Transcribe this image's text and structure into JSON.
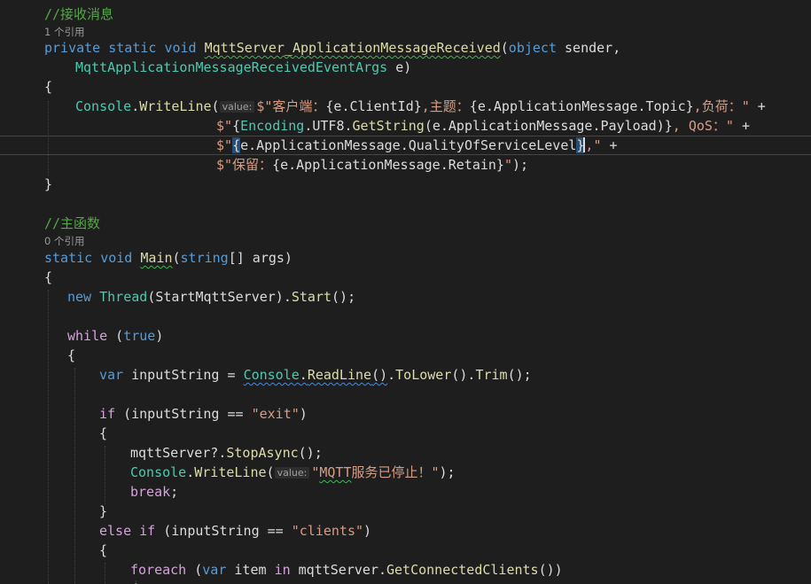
{
  "editor": {
    "theme": {
      "background": "#1e1e1e",
      "keyword": "#569cd6",
      "type": "#4ec9b0",
      "method": "#dcdcaa",
      "string": "#d69d85",
      "comment": "#57a64a",
      "control": "#d8a0df"
    },
    "lines": [
      {
        "kind": "code",
        "tokens": [
          {
            "t": "//接收消息",
            "c": "comment"
          }
        ]
      },
      {
        "kind": "lens",
        "tokens": [
          {
            "t": "1 个引用",
            "c": "lens"
          }
        ]
      },
      {
        "kind": "code",
        "tokens": [
          {
            "t": "private",
            "c": "kw"
          },
          {
            "t": " ",
            "c": "id"
          },
          {
            "t": "static",
            "c": "kw"
          },
          {
            "t": " ",
            "c": "id"
          },
          {
            "t": "void",
            "c": "kw"
          },
          {
            "t": " ",
            "c": "id"
          },
          {
            "t": "MqttServer_ApplicationMessageReceived",
            "c": "method",
            "u": "squig"
          },
          {
            "t": "(",
            "c": "id"
          },
          {
            "t": "object",
            "c": "kw"
          },
          {
            "t": " sender,",
            "c": "id"
          }
        ]
      },
      {
        "kind": "code",
        "tokens": [
          {
            "t": "MqttApplicationMessageReceivedEventArgs",
            "c": "type"
          },
          {
            "t": " e)",
            "c": "id"
          }
        ]
      },
      {
        "kind": "code",
        "tokens": [
          {
            "t": "{",
            "c": "id"
          }
        ]
      },
      {
        "kind": "code",
        "tokens": [
          {
            "t": "Console",
            "c": "type"
          },
          {
            "t": ".",
            "c": "id"
          },
          {
            "t": "WriteLine",
            "c": "method"
          },
          {
            "t": "(",
            "c": "id"
          },
          {
            "t": "value:",
            "c": "hint"
          },
          {
            "t": "$\"客户端：",
            "c": "str"
          },
          {
            "t": "{e.ClientId}",
            "c": "id"
          },
          {
            "t": ",主题：",
            "c": "str"
          },
          {
            "t": "{e.ApplicationMessage.Topic}",
            "c": "id"
          },
          {
            "t": ",负荷：\"",
            "c": "str"
          },
          {
            "t": " +",
            "c": "id"
          }
        ]
      },
      {
        "kind": "code",
        "tokens": [
          {
            "t": "$\"",
            "c": "str"
          },
          {
            "t": "{",
            "c": "id"
          },
          {
            "t": "Encoding",
            "c": "type"
          },
          {
            "t": ".UTF8.",
            "c": "id"
          },
          {
            "t": "GetString",
            "c": "method"
          },
          {
            "t": "(e.ApplicationMessage.Payload)}",
            "c": "id"
          },
          {
            "t": ", QoS：\"",
            "c": "str"
          },
          {
            "t": " +",
            "c": "id"
          }
        ]
      },
      {
        "kind": "code",
        "tokens": [
          {
            "t": "$\"",
            "c": "str"
          },
          {
            "t": "{",
            "c": "id",
            "u": "sel"
          },
          {
            "t": "e.ApplicationMessage.QualityOfServiceLevel",
            "c": "id"
          },
          {
            "t": "}",
            "c": "id",
            "u": "sel"
          },
          {
            "t": ",\"",
            "c": "str"
          },
          {
            "t": " +",
            "c": "id"
          }
        ]
      },
      {
        "kind": "code",
        "tokens": [
          {
            "t": "$\"保留：",
            "c": "str"
          },
          {
            "t": "{e.ApplicationMessage.Retain}",
            "c": "id"
          },
          {
            "t": "\"",
            "c": "str"
          },
          {
            "t": ");",
            "c": "id"
          }
        ]
      },
      {
        "kind": "code",
        "tokens": [
          {
            "t": "}",
            "c": "id"
          }
        ]
      },
      {
        "kind": "code",
        "tokens": [
          {
            "t": "//主函数",
            "c": "comment"
          }
        ]
      },
      {
        "kind": "lens",
        "tokens": [
          {
            "t": "0 个引用",
            "c": "lens"
          }
        ]
      },
      {
        "kind": "code",
        "tokens": [
          {
            "t": "static",
            "c": "kw"
          },
          {
            "t": " ",
            "c": "id"
          },
          {
            "t": "void",
            "c": "kw"
          },
          {
            "t": " ",
            "c": "id"
          },
          {
            "t": "Main",
            "c": "method",
            "u": "squig"
          },
          {
            "t": "(",
            "c": "id"
          },
          {
            "t": "string",
            "c": "kw"
          },
          {
            "t": "[] args)",
            "c": "id"
          }
        ]
      },
      {
        "kind": "code",
        "tokens": [
          {
            "t": "{",
            "c": "id"
          }
        ]
      },
      {
        "kind": "code",
        "tokens": [
          {
            "t": "new",
            "c": "kw"
          },
          {
            "t": " ",
            "c": "id"
          },
          {
            "t": "Thread",
            "c": "type"
          },
          {
            "t": "(StartMqttServer).",
            "c": "id"
          },
          {
            "t": "Start",
            "c": "method"
          },
          {
            "t": "();",
            "c": "id"
          }
        ]
      },
      {
        "kind": "code",
        "tokens": [
          {
            "t": "while",
            "c": "control"
          },
          {
            "t": " (",
            "c": "id"
          },
          {
            "t": "true",
            "c": "kw"
          },
          {
            "t": ")",
            "c": "id"
          }
        ]
      },
      {
        "kind": "code",
        "tokens": [
          {
            "t": "{",
            "c": "id"
          }
        ]
      },
      {
        "kind": "code",
        "tokens": [
          {
            "t": "var",
            "c": "kw"
          },
          {
            "t": " inputString = ",
            "c": "id"
          },
          {
            "t": "Console",
            "c": "type",
            "u": "squigb"
          },
          {
            "t": ".",
            "c": "id",
            "u": "squigb"
          },
          {
            "t": "ReadLine",
            "c": "method",
            "u": "squigb"
          },
          {
            "t": "()",
            "c": "id",
            "u": "squigb"
          },
          {
            "t": ".",
            "c": "id"
          },
          {
            "t": "ToLower",
            "c": "method"
          },
          {
            "t": "().",
            "c": "id"
          },
          {
            "t": "Trim",
            "c": "method"
          },
          {
            "t": "();",
            "c": "id"
          }
        ]
      },
      {
        "kind": "code",
        "tokens": [
          {
            "t": "if",
            "c": "control"
          },
          {
            "t": " (inputString == ",
            "c": "id"
          },
          {
            "t": "\"exit\"",
            "c": "str"
          },
          {
            "t": ")",
            "c": "id"
          }
        ]
      },
      {
        "kind": "code",
        "tokens": [
          {
            "t": "{",
            "c": "id"
          }
        ]
      },
      {
        "kind": "code",
        "tokens": [
          {
            "t": "mqttServer?.",
            "c": "id"
          },
          {
            "t": "StopAsync",
            "c": "method"
          },
          {
            "t": "();",
            "c": "id"
          }
        ]
      },
      {
        "kind": "code",
        "tokens": [
          {
            "t": "Console",
            "c": "type"
          },
          {
            "t": ".",
            "c": "id"
          },
          {
            "t": "WriteLine",
            "c": "method"
          },
          {
            "t": "(",
            "c": "id"
          },
          {
            "t": "value:",
            "c": "hint"
          },
          {
            "t": "\"",
            "c": "str"
          },
          {
            "t": "MQTT",
            "c": "str",
            "u": "squig"
          },
          {
            "t": "服务已停止！\"",
            "c": "str"
          },
          {
            "t": ");",
            "c": "id"
          }
        ]
      },
      {
        "kind": "code",
        "tokens": [
          {
            "t": "break",
            "c": "control"
          },
          {
            "t": ";",
            "c": "id"
          }
        ]
      },
      {
        "kind": "code",
        "tokens": [
          {
            "t": "}",
            "c": "id"
          }
        ]
      },
      {
        "kind": "code",
        "tokens": [
          {
            "t": "else",
            "c": "control"
          },
          {
            "t": " ",
            "c": "id"
          },
          {
            "t": "if",
            "c": "control"
          },
          {
            "t": " (inputString == ",
            "c": "id"
          },
          {
            "t": "\"clients\"",
            "c": "str"
          },
          {
            "t": ")",
            "c": "id"
          }
        ]
      },
      {
        "kind": "code",
        "tokens": [
          {
            "t": "{",
            "c": "id"
          }
        ]
      },
      {
        "kind": "code",
        "tokens": [
          {
            "t": "foreach",
            "c": "control"
          },
          {
            "t": " (",
            "c": "id"
          },
          {
            "t": "var",
            "c": "kw"
          },
          {
            "t": " item ",
            "c": "id"
          },
          {
            "t": "in",
            "c": "control"
          },
          {
            "t": " mqttServer.",
            "c": "id"
          },
          {
            "t": "GetConnectedClients",
            "c": "method"
          },
          {
            "t": "())",
            "c": "id"
          }
        ]
      },
      {
        "kind": "code",
        "tokens": [
          {
            "t": "{",
            "c": "id"
          }
        ]
      }
    ]
  }
}
